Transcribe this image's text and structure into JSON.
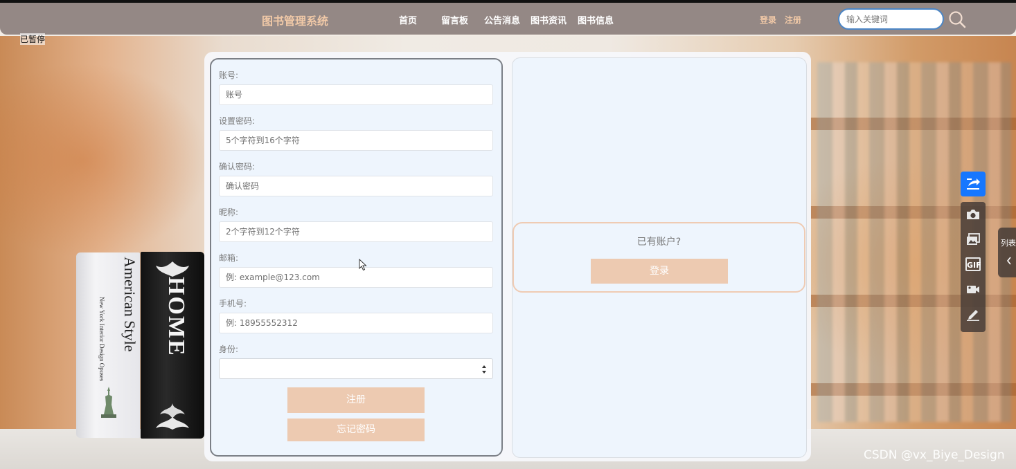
{
  "header": {
    "brand": "图书管理系统",
    "nav": [
      {
        "label": "首页"
      },
      {
        "label": "留言板"
      },
      {
        "label": "公告消息"
      },
      {
        "label": "图书资讯"
      },
      {
        "label": "图书信息"
      }
    ],
    "login_link": "登录",
    "register_link": "注册",
    "search_placeholder": "输入关键词"
  },
  "status": {
    "paused": "已暂停"
  },
  "register_form": {
    "fields": [
      {
        "label": "账号:",
        "placeholder": "账号"
      },
      {
        "label": "设置密码:",
        "placeholder": "5个字符到16个字符"
      },
      {
        "label": "确认密码:",
        "placeholder": "确认密码"
      },
      {
        "label": "昵称:",
        "placeholder": "2个字符到12个字符"
      },
      {
        "label": "邮箱:",
        "placeholder": "例: example@123.com"
      },
      {
        "label": "手机号:",
        "placeholder": "例: 18955552312"
      }
    ],
    "role_label": "身份:",
    "role_value": "",
    "submit_label": "注册",
    "forgot_label": "忘记密码"
  },
  "login_side": {
    "prompt": "已有账户?",
    "login_button": "登录"
  },
  "side_tools": {
    "list_tab_label": "列表",
    "gif_label": "GIF"
  },
  "background_books": {
    "white_title": "American Style",
    "white_subtitle": "New York Interior Design Opuses",
    "black_title": "HOME"
  },
  "watermark": "CSDN @vx_Biye_Design",
  "colors": {
    "header_bg": "#948885",
    "brand": "#f1c9a7",
    "accent_button": "#edcab1",
    "panel_bg": "#eef5fd",
    "share_blue": "#1677ff"
  }
}
